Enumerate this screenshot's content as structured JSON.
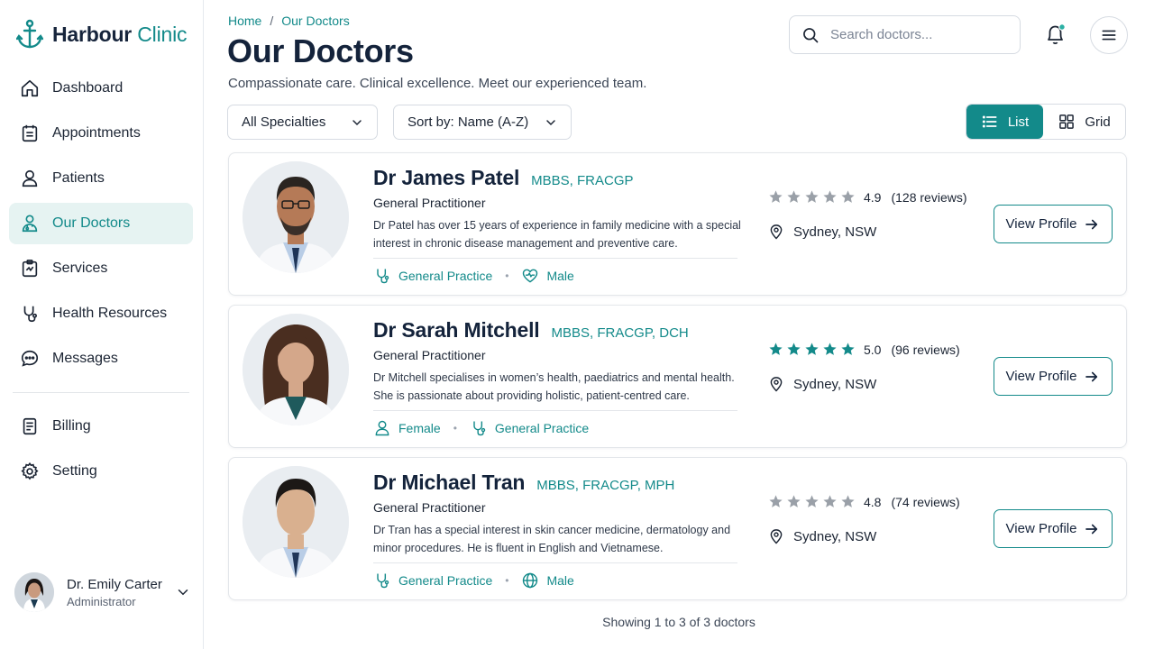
{
  "brand": {
    "name_part1": "Harbour",
    "name_part2": "Clinic",
    "icon": "anchor-icon"
  },
  "sidebar": {
    "items": [
      {
        "label": "Dashboard",
        "icon": "home-icon",
        "active": false
      },
      {
        "label": "Appointments",
        "icon": "calendar-icon",
        "active": false
      },
      {
        "label": "Patients",
        "icon": "user-icon",
        "active": false
      },
      {
        "label": "Our Doctors",
        "icon": "doctor-icon",
        "active": true
      },
      {
        "label": "Services",
        "icon": "clipboard-icon",
        "active": false
      },
      {
        "label": "Health Resources",
        "icon": "stethoscope-icon",
        "active": false
      },
      {
        "label": "Messages",
        "icon": "chat-icon",
        "active": false
      }
    ],
    "secondary_items": [
      {
        "label": "Billing",
        "icon": "receipt-icon"
      },
      {
        "label": "Setting",
        "icon": "gear-icon"
      }
    ]
  },
  "user": {
    "name": "Dr. Emily Carter",
    "role": "Administrator"
  },
  "breadcrumb": {
    "home": "Home",
    "separator": "/",
    "current": "Our Doctors"
  },
  "header": {
    "title": "Our Doctors",
    "subtitle": "Compassionate care. Clinical excellence. Meet our experienced team."
  },
  "search": {
    "placeholder": "Search doctors...",
    "value": ""
  },
  "filters": {
    "specialty": "All Specialties",
    "sort": "Sort by: Name (A-Z)"
  },
  "view_toggle": {
    "list_label": "List",
    "grid_label": "Grid",
    "selected": "List"
  },
  "doctors": [
    {
      "name": "Dr James Patel",
      "qualifications": "MBBS, FRACGP",
      "role": "General Practitioner",
      "bio": "Dr Patel has over 15 years of experience in family medicine with a special interest in chronic disease management and preventive care.",
      "tags": [
        {
          "label": "General Practice",
          "icon": "stethoscope-icon"
        },
        {
          "label": "Male",
          "icon": "heart-icon"
        }
      ],
      "rating": "4.9",
      "stars_filled": 0,
      "reviews": "(128 reviews)",
      "location": "Sydney, NSW",
      "button": "View Profile"
    },
    {
      "name": "Dr Sarah Mitchell",
      "qualifications": "MBBS, FRACGP, DCH",
      "role": "General Practitioner",
      "bio": "Dr Mitchell specialises in women’s health, paediatrics and mental health. She is passionate about providing holistic, patient-centred care.",
      "tags": [
        {
          "label": "Female",
          "icon": "user-icon"
        },
        {
          "label": "General Practice",
          "icon": "stethoscope-icon"
        }
      ],
      "rating": "5.0",
      "stars_filled": 5,
      "reviews": "(96 reviews)",
      "location": "Sydney, NSW",
      "button": "View Profile"
    },
    {
      "name": "Dr Michael Tran",
      "qualifications": "MBBS, FRACGP, MPH",
      "role": "General Practitioner",
      "bio": "Dr Tran has a special interest in skin cancer medicine, dermatology and minor procedures. He is fluent in English and Vietnamese.",
      "tags": [
        {
          "label": "General Practice",
          "icon": "stethoscope-icon"
        },
        {
          "label": "Male",
          "icon": "globe-icon"
        }
      ],
      "rating": "4.8",
      "stars_filled": 0,
      "reviews": "(74 reviews)",
      "location": "Sydney, NSW",
      "button": "View Profile"
    }
  ],
  "footer": {
    "count_text": "Showing 1 to 3 of 3 doctors"
  },
  "colors": {
    "accent": "#138a8a",
    "accent_light": "#e6f3f2",
    "title": "#14233b",
    "star_grey": "#9aa0a8",
    "notification_dot": "#2bb0a4"
  }
}
